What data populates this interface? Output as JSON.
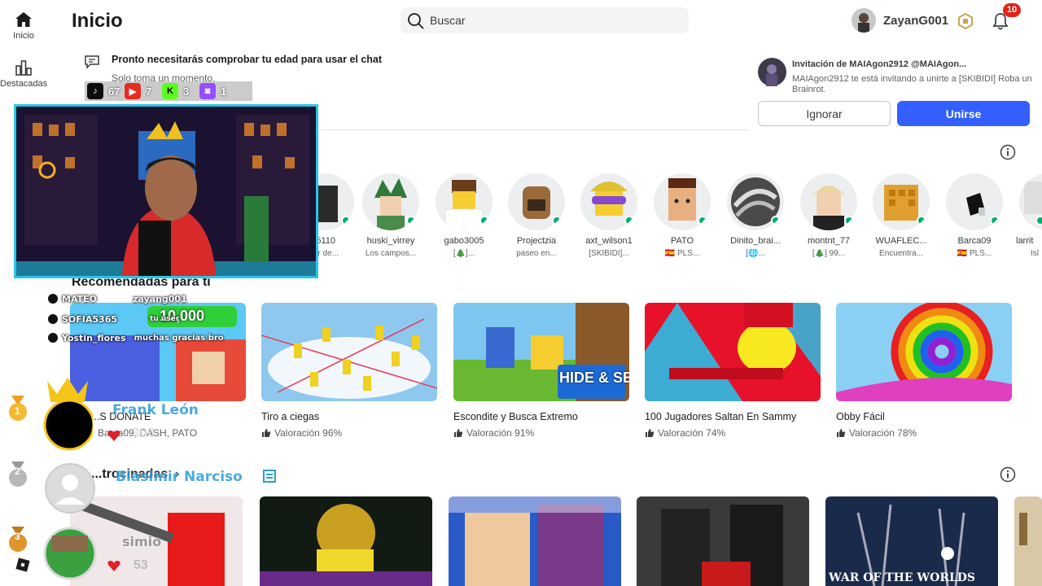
{
  "nav": {
    "items": [
      {
        "label": "Inicio"
      },
      {
        "label": "Destacadas"
      }
    ]
  },
  "header": {
    "title": "Inicio",
    "search_placeholder": "Buscar",
    "username": "ZayanG001",
    "notifications": "10"
  },
  "age_notice": {
    "title": "Pronto necesitarás comprobar tu edad para usar el chat",
    "subtitle": "Solo toma un momento."
  },
  "invite": {
    "title": "Invitación de MAIAgon2912 @MAIAgon...",
    "message": "MAIAgon2912 te está invitando a unirte a [SKIBIDI] Roba un Brainrot.",
    "ignore_label": "Ignorar",
    "join_label": "Unirse"
  },
  "friends": [
    {
      "name": "...5110",
      "status": "...r de..."
    },
    {
      "name": "huski_virrey",
      "status": "Los campos..."
    },
    {
      "name": "gabo3005",
      "status": "[🎄]..."
    },
    {
      "name": "Projectzia",
      "status": "paseo en..."
    },
    {
      "name": "axt_wilson1",
      "status": "[SKIBIDI]..."
    },
    {
      "name": "PATO",
      "status": "🇪🇸 PLS..."
    },
    {
      "name": "Dinito_brai...",
      "status": "[🌐..."
    },
    {
      "name": "montnt_77",
      "status": "[🎄] 99..."
    },
    {
      "name": "WUAFLEC...",
      "status": "Encuentra..."
    },
    {
      "name": "Barca09",
      "status": "🇪🇸 PLS..."
    },
    {
      "name": "larrit",
      "status": "Isl"
    }
  ],
  "recommended": {
    "title": "Recomendadas para ti",
    "games": [
      {
        "name": "...S DONATE",
        "rating": "Barca09, DASH, PATO",
        "thumb_text": "10,000"
      },
      {
        "name": "Tiro a ciegas",
        "rating": "Valoración 96%"
      },
      {
        "name": "Escondite y Busca Extremo",
        "rating": "Valoración 91%",
        "thumb_text": "HIDE & SEEK"
      },
      {
        "name": "100 Jugadores Saltan En Sammy",
        "rating": "Valoración 74%"
      },
      {
        "name": "Obby Fácil",
        "rating": "Valoración 78%"
      }
    ]
  },
  "sponsored": {
    "title": "...trocinadas",
    "last_thumb_text": "WAR OF THE WORLDS"
  },
  "stream": {
    "socials": [
      {
        "icon": "tiktok-icon",
        "count": "67",
        "color": "#000000"
      },
      {
        "icon": "youtube-icon",
        "count": "7",
        "color": "#e62117"
      },
      {
        "icon": "kick-icon",
        "count": "3",
        "color": "#53fc18"
      },
      {
        "icon": "twitch-icon",
        "count": "1",
        "color": "#9146ff"
      }
    ],
    "chat": [
      {
        "user": "MATEO",
        "text": "zayang001"
      },
      {
        "user": "SOFIA5365",
        "text": "tu user"
      },
      {
        "user": "Yostin_flores",
        "text": "muchas gracias bro"
      }
    ],
    "leaders": [
      {
        "rank": "1",
        "name": "Frank León",
        "score": "300"
      },
      {
        "rank": "2",
        "name": "Blasimir Narciso",
        "score": ""
      },
      {
        "rank": "3",
        "name": "simio",
        "score": "53"
      }
    ]
  }
}
